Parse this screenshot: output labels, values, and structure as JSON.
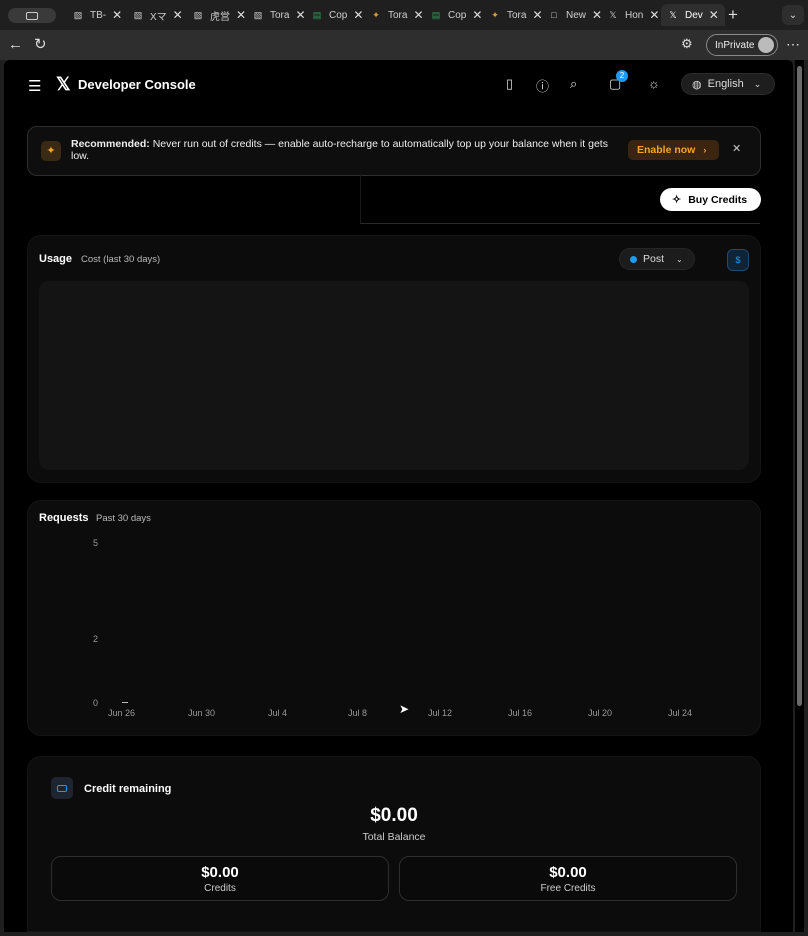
{
  "browser": {
    "tabs": [
      {
        "label": "TB-",
        "fav": "▧"
      },
      {
        "label": "Xマ",
        "fav": "▧"
      },
      {
        "label": "虎営",
        "fav": "▧"
      },
      {
        "label": "Tora",
        "fav": "▧"
      },
      {
        "label": "Cop",
        "fav": "▤"
      },
      {
        "label": "Tora",
        "fav": "✦"
      },
      {
        "label": "Cop",
        "fav": "▤"
      },
      {
        "label": "Tora",
        "fav": "✦"
      },
      {
        "label": "New",
        "fav": "□"
      },
      {
        "label": "Hon",
        "fav": "𝕏"
      },
      {
        "label": "Dev",
        "fav": "𝕏"
      }
    ],
    "inprivate_label": "InPrivate"
  },
  "header": {
    "logo": "𝕏",
    "title": "Developer Console",
    "notification_count": "2",
    "language": "English"
  },
  "banner": {
    "strong": "Recommended:",
    "text": "Never run out of credits — enable auto-recharge to automatically top up your balance when it gets low.",
    "enable_label": "Enable now"
  },
  "buy_credits_label": "Buy Credits",
  "usage": {
    "title": "Usage",
    "subtitle": "Cost (last 30 days)",
    "filter": "Post"
  },
  "requests": {
    "title": "Requests",
    "subtitle": "Past 30 days"
  },
  "chart_data": {
    "type": "bar",
    "title": "Requests",
    "subtitle": "Past 30 days",
    "x_ticks": [
      "Jun 26",
      "Jun 30",
      "Jul 4",
      "Jul 8",
      "Jul 12",
      "Jul 16",
      "Jul 20",
      "Jul 24"
    ],
    "y_ticks": [
      "5",
      "2",
      "0"
    ],
    "ylim": [
      0,
      5
    ],
    "values": [
      0
    ]
  },
  "credits": {
    "title": "Credit remaining",
    "total": "$0.00",
    "total_label": "Total Balance",
    "credits_value": "$0.00",
    "credits_label": "Credits",
    "free_value": "$0.00",
    "free_label": "Free Credits"
  }
}
